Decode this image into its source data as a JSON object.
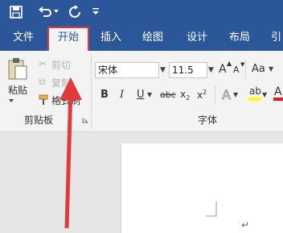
{
  "titlebar": {
    "save_icon": "save-icon",
    "undo_icon": "undo-icon",
    "redo_icon": "redo-icon",
    "customize_icon": "customize-quick-access-icon"
  },
  "tabs": {
    "file": "文件",
    "home": "开始",
    "insert": "插入",
    "draw": "绘图",
    "design": "设计",
    "layout": "布局",
    "references": "引"
  },
  "clipboard": {
    "paste_label": "粘贴",
    "cut_label": "剪切",
    "copy_label": "复制",
    "format_painter_label": "格式刷",
    "group_label": "剪贴板"
  },
  "font": {
    "font_name": "宋体",
    "font_size": "11.5",
    "grow_label": "A",
    "shrink_label": "A",
    "case_label": "Aa",
    "bold": "B",
    "italic": "I",
    "underline": "U",
    "strikethrough": "abc",
    "subscript": "x",
    "subscript_mark": "2",
    "superscript": "x",
    "superscript_mark": "2",
    "text_effects": "A",
    "highlight_label": "ab",
    "font_color": "A",
    "group_label": "字体"
  },
  "colors": {
    "title_bar": "#2b579a",
    "ribbon": "#f3f3f3",
    "highlight_annotation": "#e03a3a",
    "highlight_yellow": "#ffff00",
    "font_color_red": "#e02020"
  }
}
